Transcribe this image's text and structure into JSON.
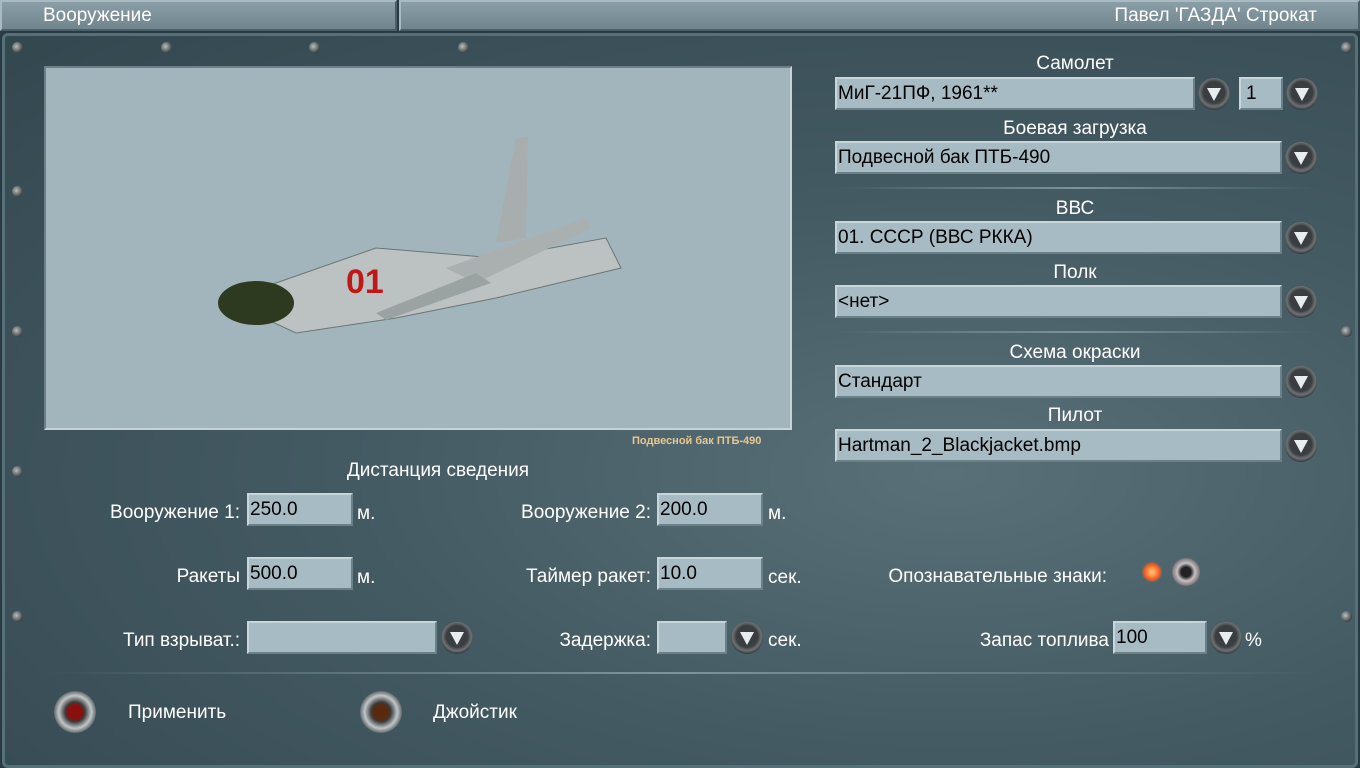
{
  "header": {
    "title": "Вооружение",
    "user": "Павел 'ГАЗДА' Строкат"
  },
  "preview": {
    "caption": "Подвесной бак ПТБ-490",
    "tail_number": "01"
  },
  "aircraft": {
    "label": "Самолет",
    "value": "МиГ-21ПФ, 1961**",
    "count": "1"
  },
  "loadout": {
    "label": "Боевая загрузка",
    "value": "Подвесной бак ПТБ-490"
  },
  "airforce": {
    "label": "ВВС",
    "value": "01. СССР (ВВС РККА)"
  },
  "regiment": {
    "label": "Полк",
    "value": "<нет>"
  },
  "skin": {
    "label": "Схема окраски",
    "value": "Стандарт"
  },
  "pilot": {
    "label": "Пилот",
    "value": "Hartman_2_Blackjacket.bmp"
  },
  "convergence": {
    "title": "Дистанция сведения",
    "weapon1_label": "Вооружение 1:",
    "weapon1_value": "250.0",
    "weapon1_unit": "м.",
    "weapon2_label": "Вооружение 2:",
    "weapon2_value": "200.0",
    "weapon2_unit": "м.",
    "rockets_label": "Ракеты",
    "rockets_value": "500.0",
    "rockets_unit": "м.",
    "rocket_timer_label": "Таймер ракет:",
    "rocket_timer_value": "10.0",
    "rocket_timer_unit": "сек.",
    "fuze_label": "Тип взрыват.:",
    "fuze_value": "",
    "delay_label": "Задержка:",
    "delay_value": "",
    "delay_unit": "сек."
  },
  "markings": {
    "label": "Опознавательные знаки:",
    "enabled": true
  },
  "fuel": {
    "label": "Запас топлива",
    "value": "100",
    "unit": "%"
  },
  "buttons": {
    "apply": "Применить",
    "joystick": "Джойстик"
  }
}
